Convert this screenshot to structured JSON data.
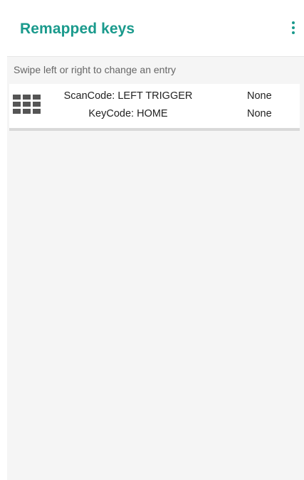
{
  "app_bar": {
    "title": "Remapped keys",
    "accent_color": "#1a9a8c",
    "overflow_icon": "more-vert-icon"
  },
  "content": {
    "hint": "Swipe left or right to change an entry",
    "entries": [
      {
        "icon": "keypad-icon",
        "scan_code": "ScanCode: LEFT TRIGGER",
        "scan_value": "None",
        "key_code": "KeyCode: HOME",
        "key_value": "None"
      }
    ]
  }
}
